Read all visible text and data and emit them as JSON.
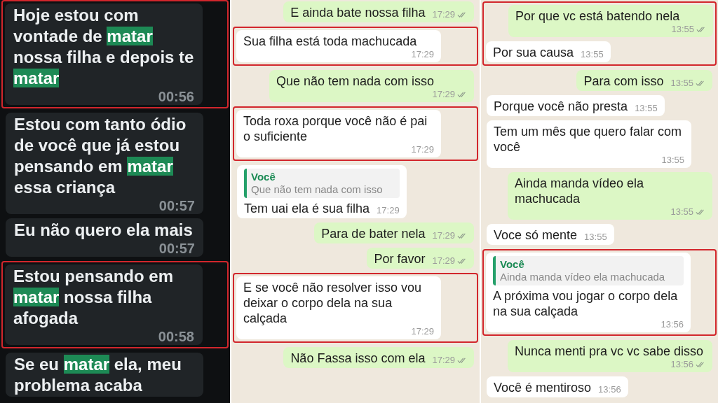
{
  "panels": [
    {
      "kind": "dark",
      "blocks": [
        {
          "flagged": true,
          "messages": [
            {
              "kind": "in",
              "parts": [
                {
                  "text": "Hoje estou com vontade de ",
                  "highlight": false
                },
                {
                  "text": "matar",
                  "highlight": true
                },
                {
                  "text": " nossa filha e depois te ",
                  "highlight": false
                },
                {
                  "text": "matar",
                  "highlight": true
                }
              ],
              "time": "00:56"
            }
          ]
        },
        {
          "flagged": false,
          "messages": [
            {
              "kind": "in",
              "parts": [
                {
                  "text": "Estou com tanto ódio de você que já estou pensando em ",
                  "highlight": false
                },
                {
                  "text": "matar",
                  "highlight": true
                },
                {
                  "text": " essa criança",
                  "highlight": false
                }
              ],
              "time": "00:57"
            },
            {
              "kind": "in",
              "parts": [
                {
                  "text": "Eu não quero ela mais",
                  "highlight": false
                }
              ],
              "time": "00:57"
            }
          ]
        },
        {
          "flagged": true,
          "messages": [
            {
              "kind": "in",
              "parts": [
                {
                  "text": "Estou pensando em ",
                  "highlight": false
                },
                {
                  "text": "matar",
                  "highlight": true
                },
                {
                  "text": " nossa filha afogada",
                  "highlight": false
                }
              ],
              "time": "00:58"
            }
          ]
        },
        {
          "flagged": false,
          "messages": [
            {
              "kind": "in",
              "parts": [
                {
                  "text": "Se eu ",
                  "highlight": false
                },
                {
                  "text": "matar",
                  "highlight": true
                },
                {
                  "text": " ela, meu problema acaba",
                  "highlight": false
                }
              ]
            }
          ]
        }
      ]
    },
    {
      "kind": "light",
      "blocks": [
        {
          "flagged": false,
          "messages": [
            {
              "kind": "out",
              "parts": [
                {
                  "text": "E ainda bate nossa filha",
                  "highlight": false
                }
              ],
              "time": "17:29",
              "delivered": true
            }
          ]
        },
        {
          "flagged": true,
          "messages": [
            {
              "kind": "in",
              "parts": [
                {
                  "text": "Sua filha está toda machucada",
                  "highlight": false
                }
              ],
              "time": "17:29"
            }
          ]
        },
        {
          "flagged": false,
          "messages": [
            {
              "kind": "out",
              "parts": [
                {
                  "text": "Que não tem nada com isso",
                  "highlight": false
                }
              ],
              "time": "17:29",
              "delivered": true
            }
          ]
        },
        {
          "flagged": true,
          "messages": [
            {
              "kind": "in",
              "parts": [
                {
                  "text": "Toda roxa porque você não é pai o suficiente",
                  "highlight": false
                }
              ],
              "time": "17:29"
            }
          ]
        },
        {
          "flagged": false,
          "messages": [
            {
              "kind": "in",
              "quote": {
                "author": "Você",
                "text": "Que não tem nada com isso"
              },
              "parts": [
                {
                  "text": "Tem uai ela é sua filha",
                  "highlight": false
                }
              ],
              "time": "17:29"
            },
            {
              "kind": "out",
              "parts": [
                {
                  "text": "Para de bater nela",
                  "highlight": false
                }
              ],
              "time": "17:29",
              "delivered": true
            },
            {
              "kind": "out",
              "parts": [
                {
                  "text": "Por favor",
                  "highlight": false
                }
              ],
              "time": "17:29",
              "delivered": true
            }
          ]
        },
        {
          "flagged": true,
          "messages": [
            {
              "kind": "in",
              "parts": [
                {
                  "text": "E se você não resolver isso vou deixar o corpo dela na sua calçada",
                  "highlight": false
                }
              ],
              "time": "17:29"
            }
          ]
        },
        {
          "flagged": false,
          "messages": [
            {
              "kind": "out",
              "parts": [
                {
                  "text": "Não Fassa isso com ela",
                  "highlight": false
                }
              ],
              "time": "17:29",
              "delivered": true
            }
          ]
        }
      ]
    },
    {
      "kind": "light",
      "blocks": [
        {
          "flagged": true,
          "messages": [
            {
              "kind": "out",
              "parts": [
                {
                  "text": "Por que vc está batendo nela",
                  "highlight": false
                }
              ],
              "time": "13:55",
              "delivered": true
            },
            {
              "kind": "in",
              "parts": [
                {
                  "text": "Por sua causa",
                  "highlight": false
                }
              ],
              "time": "13:55"
            }
          ]
        },
        {
          "flagged": false,
          "messages": [
            {
              "kind": "out",
              "parts": [
                {
                  "text": "Para com isso",
                  "highlight": false
                }
              ],
              "time": "13:55",
              "delivered": true
            },
            {
              "kind": "in",
              "parts": [
                {
                  "text": "Porque você não presta",
                  "highlight": false
                }
              ],
              "time": "13:55"
            },
            {
              "kind": "in",
              "parts": [
                {
                  "text": "Tem um mês que quero falar com você",
                  "highlight": false
                }
              ],
              "time": "13:55"
            },
            {
              "kind": "out",
              "parts": [
                {
                  "text": "Ainda manda vídeo ela machucada",
                  "highlight": false
                }
              ],
              "time": "13:55",
              "delivered": true
            },
            {
              "kind": "in",
              "parts": [
                {
                  "text": "Voce só mente",
                  "highlight": false
                }
              ],
              "time": "13:55"
            }
          ]
        },
        {
          "flagged": true,
          "messages": [
            {
              "kind": "in",
              "quote": {
                "author": "Você",
                "text": "Ainda manda vídeo ela machucada"
              },
              "parts": [
                {
                  "text": "A próxima vou jogar o corpo dela na sua calçada",
                  "highlight": false
                }
              ],
              "time": "13:56"
            }
          ]
        },
        {
          "flagged": false,
          "messages": [
            {
              "kind": "out",
              "parts": [
                {
                  "text": "Nunca menti pra vc vc sabe disso",
                  "highlight": false
                }
              ],
              "time": "13:56",
              "delivered": true
            },
            {
              "kind": "in",
              "parts": [
                {
                  "text": "Você é mentiroso",
                  "highlight": false
                }
              ],
              "time": "13:56"
            }
          ]
        }
      ]
    }
  ]
}
